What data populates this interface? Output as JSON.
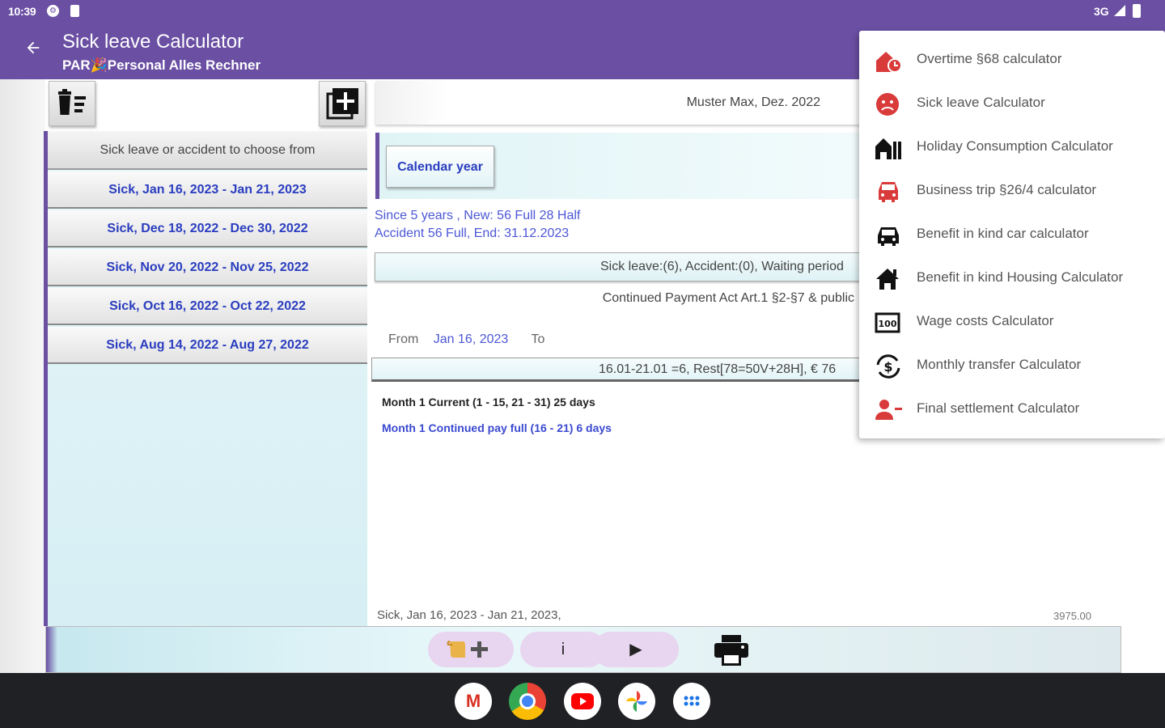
{
  "status_bar": {
    "time": "10:39",
    "network": "3G"
  },
  "app_bar": {
    "title": "Sick leave Calculator",
    "subtitle": "PAR🎉Personal Alles Rechner"
  },
  "document": {
    "title": "Muster Max, Dez. 2022"
  },
  "list": {
    "header": "Sick leave or accident to choose from",
    "items": [
      "Sick, Jan 16, 2023 - Jan 21, 2023",
      "Sick, Dec 18, 2022 - Dec 30, 2022",
      "Sick, Nov 20, 2022 - Nov 25, 2022",
      "Sick, Oct 16, 2022 - Oct 22, 2022",
      "Sick, Aug 14, 2022 - Aug 27, 2022"
    ]
  },
  "year_button": "Calendar year",
  "info": {
    "line1": "Since  5 years , New: 56 Full 28 Half",
    "line2": "Accident 56 Full, End: 31.12.2023"
  },
  "summary": "Sick leave:(6), Accident:(0), Waiting period",
  "act": "Continued Payment Act Art.1 §2-§7 & public",
  "period": {
    "from_label": "From",
    "from_value": "Jan 16, 2023",
    "to_label": "To"
  },
  "detail": "16.01-21.01 =6, Rest[78=50V+28H], €  76",
  "months": [
    {
      "text": "Month 1 Current (1 - 15, 21 - 31) 25 days",
      "color": "#222222"
    },
    {
      "text": "Month 1 Continued pay full (16 - 21) 6 days",
      "color": "#3a49d0"
    }
  ],
  "result": {
    "label": "Sick, Jan 16, 2023 - Jan 21, 2023,",
    "amount": "3975.00"
  },
  "bottom_bar": {
    "info_label": "i",
    "play_label": "▶"
  },
  "menu": {
    "items": [
      {
        "label": "Overtime §68 calculator",
        "icon": "overtime-icon",
        "color": "#d93a3a"
      },
      {
        "label": "Sick leave Calculator",
        "icon": "sick-face-icon",
        "color": "#d93a3a"
      },
      {
        "label": "Holiday Consumption Calculator",
        "icon": "holiday-icon",
        "color": "#111111"
      },
      {
        "label": "Business trip §26/4 calculator",
        "icon": "car-icon",
        "color": "#d93a3a"
      },
      {
        "label": "Benefit in kind car calculator",
        "icon": "car-icon",
        "color": "#111111"
      },
      {
        "label": "Benefit in kind Housing Calculator",
        "icon": "house-icon",
        "color": "#111111"
      },
      {
        "label": "Wage costs Calculator",
        "icon": "counter-icon",
        "color": "#111111"
      },
      {
        "label": "Monthly transfer Calculator",
        "icon": "dollar-cycle-icon",
        "color": "#111111"
      },
      {
        "label": "Final settlement Calculator",
        "icon": "person-remove-icon",
        "color": "#d93a3a"
      }
    ]
  },
  "taskbar": {
    "apps": [
      "gmail",
      "chrome",
      "youtube",
      "photos",
      "app-drawer"
    ]
  },
  "colors": {
    "primary": "#6a4fa3",
    "link": "#2a3dbf",
    "accent_red": "#d93a3a"
  }
}
